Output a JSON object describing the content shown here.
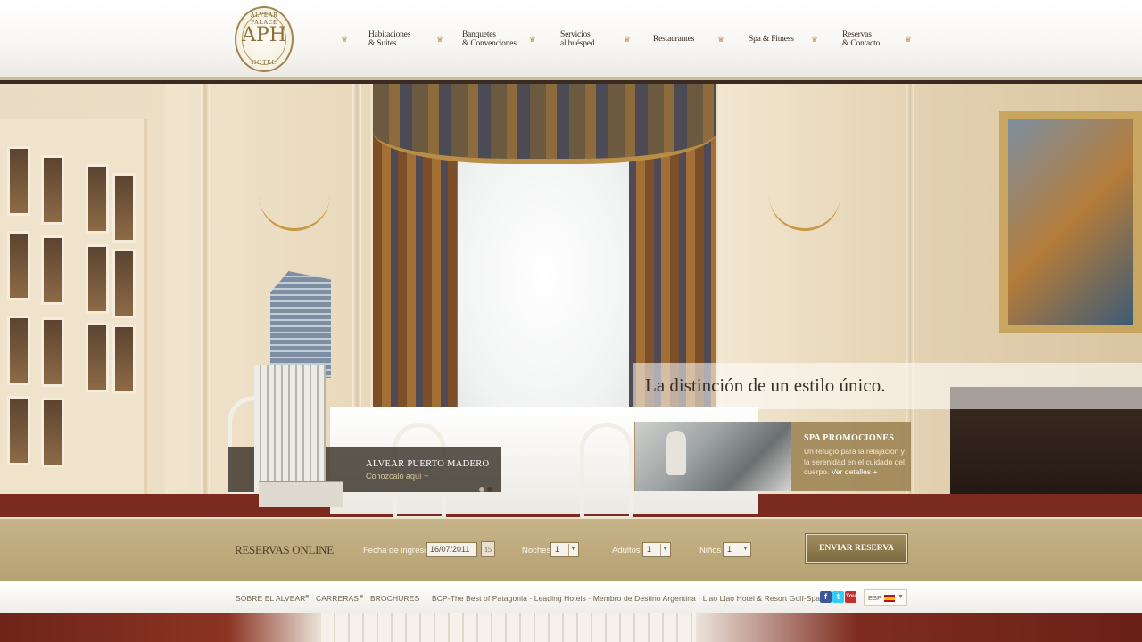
{
  "header": {
    "logo": {
      "top_text": "ALVEAR PALACE",
      "mark": "APH",
      "bottom_text": "HOTEL"
    },
    "nav": [
      {
        "line1": "Habitaciones",
        "line2": "& Suites"
      },
      {
        "line1": "Banquetes",
        "line2": "& Convenciones"
      },
      {
        "line1": "Servicios",
        "line2": "al huésped"
      },
      {
        "line1": "Restaurantes",
        "line2": ""
      },
      {
        "line1": "Spa & Fitness",
        "line2": ""
      },
      {
        "line1": "Reservas",
        "line2": "& Contacto"
      }
    ],
    "separator_glyph": "♛"
  },
  "hero": {
    "tagline": "La distinción de un estilo único.",
    "promo_madero": {
      "title": "ALVEAR PUERTO MADERO",
      "link": "Conozcalo aquí +"
    },
    "promo_spa": {
      "title": "SPA PROMOCIONES",
      "desc": "Un refugio para la relajación y la serenidad en el cuidado del cuerpo.",
      "link": "Ver detalles +"
    }
  },
  "booking": {
    "title": "RESERVAS ONLINE",
    "checkin_label": "Fecha de ingreso",
    "checkin_value": "16/07/2011",
    "calendar_icon": "15",
    "nights_label": "Noches",
    "nights_value": "1",
    "adults_label": "Adultos",
    "adults_value": "1",
    "children_label": "Niños",
    "children_value": "1",
    "submit_label": "ENVIAR RESERVA"
  },
  "footer": {
    "links": [
      "SOBRE EL ALVEAR",
      "CARRERAS",
      "BROCHURES"
    ],
    "partners": "BCP-The Best of Patagonia · Leading Hotels · Membro de Destino Argentina · Llao Llao Hotel & Resort Golf-Spa",
    "social": {
      "facebook": "f",
      "twitter": "t",
      "youtube": "You"
    },
    "language": "ESP"
  },
  "colors": {
    "gold": "#b6a171",
    "dark_text": "#3c2e22",
    "nav_accent": "#b59c5c"
  }
}
